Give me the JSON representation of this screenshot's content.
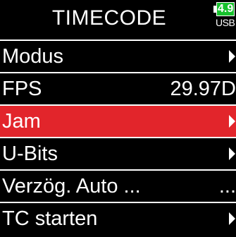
{
  "header": {
    "title": "TIMECODE",
    "battery": {
      "voltage": "4.9",
      "source": "USB",
      "color": "#17c12d"
    }
  },
  "menu": {
    "selected_color": "#e2252b",
    "items": [
      {
        "label": "Modus",
        "value": "",
        "indicator": "chevron-right-icon",
        "selected": false
      },
      {
        "label": "FPS",
        "value": "29.97D",
        "indicator": "",
        "selected": false
      },
      {
        "label": "Jam",
        "value": "",
        "indicator": "chevron-right-icon",
        "selected": true
      },
      {
        "label": "U-Bits",
        "value": "",
        "indicator": "chevron-right-icon",
        "selected": false
      },
      {
        "label": "Verzög. Auto ...",
        "value": "...",
        "indicator": "",
        "selected": false
      },
      {
        "label": "TC starten",
        "value": "",
        "indicator": "chevron-right-icon",
        "selected": false
      }
    ]
  }
}
